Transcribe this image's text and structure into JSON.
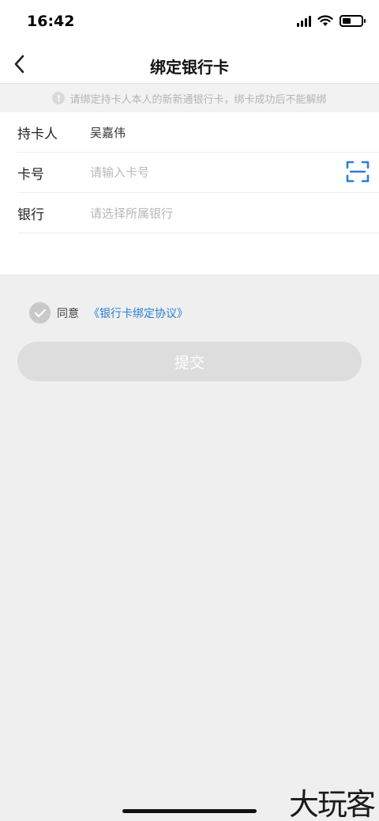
{
  "status_bar": {
    "time": "16:42",
    "battery_level": 0.45
  },
  "nav": {
    "title": "绑定银行卡",
    "back_icon": "chevron-left-icon"
  },
  "notice": {
    "icon": "!",
    "text": "请绑定持卡人本人的新新通银行卡，绑卡成功后不能解绑"
  },
  "form": {
    "holder_label": "持卡人",
    "holder_value": "吴嘉伟",
    "card_label": "卡号",
    "card_placeholder": "请输入卡号",
    "bank_label": "银行",
    "bank_placeholder": "请选择所属银行"
  },
  "agreement": {
    "prefix": "同意",
    "link": "《银行卡绑定协议》",
    "checked": false
  },
  "submit_label": "提交",
  "watermark": "大玩客",
  "colors": {
    "accent": "#2b7fd3",
    "disabled_button": "#dddddd",
    "background": "#efefef"
  }
}
